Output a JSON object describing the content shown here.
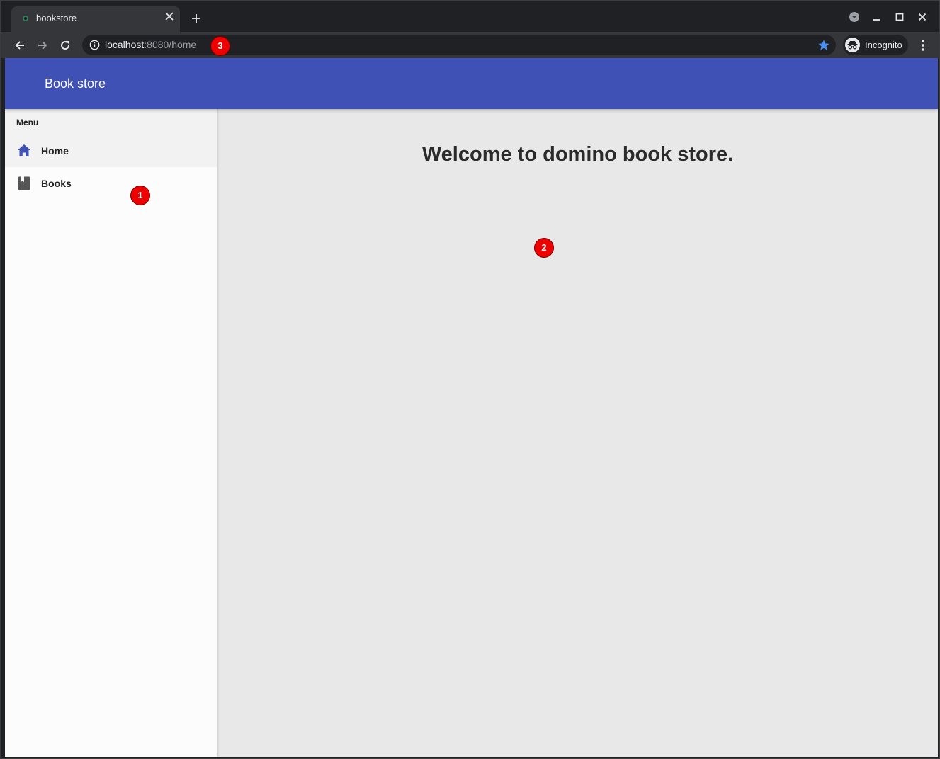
{
  "browser": {
    "tab_title": "bookstore",
    "url_host": "localhost",
    "url_rest": ":8080/home",
    "profile_label": "Incognito",
    "icons": {
      "tab_close": "close-icon",
      "new_tab": "plus-icon",
      "back": "arrow-left-icon",
      "forward": "arrow-right-icon",
      "reload": "reload-icon",
      "info": "info-icon",
      "bookmark": "star-icon",
      "menu": "kebab-icon"
    }
  },
  "app": {
    "title": "Book store",
    "theme_color": "#3f51b5",
    "sidebar": {
      "header": "Menu",
      "items": [
        {
          "label": "Home",
          "icon": "home-icon",
          "active": true,
          "icon_color": "#3f51b5"
        },
        {
          "label": "Books",
          "icon": "book-icon",
          "active": false,
          "icon_color": "#555555"
        }
      ]
    },
    "main": {
      "heading": "Welcome to domino book store."
    }
  },
  "markers": [
    {
      "label": "1"
    },
    {
      "label": "2"
    },
    {
      "label": "3"
    }
  ]
}
